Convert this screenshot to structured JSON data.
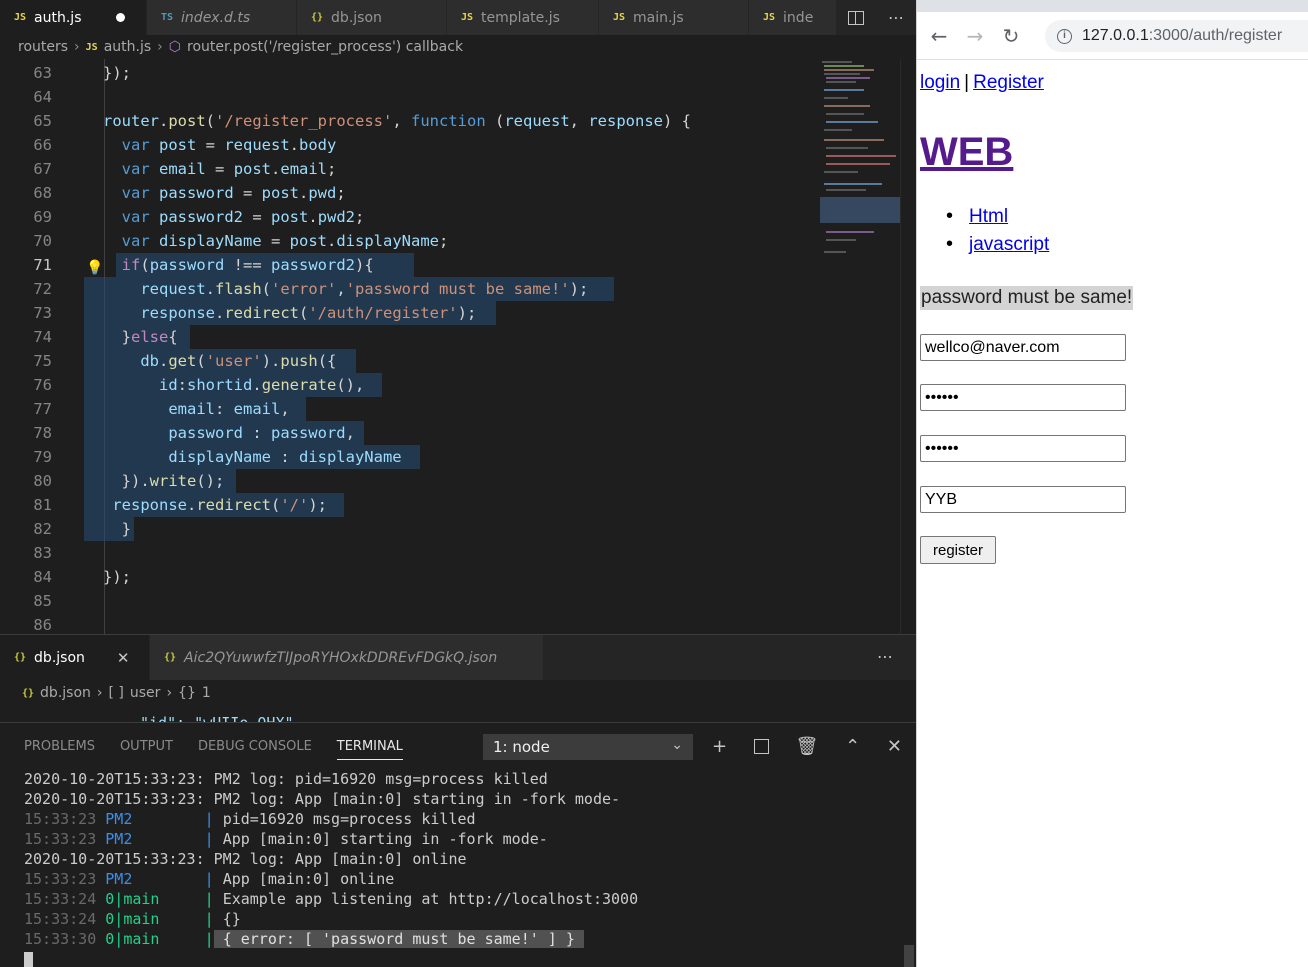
{
  "editor": {
    "tabs": [
      {
        "icon": "JS",
        "label": "auth.js",
        "dirty": true
      },
      {
        "icon": "TS",
        "label": "index.d.ts"
      },
      {
        "icon": "{}",
        "label": "db.json"
      },
      {
        "icon": "JS",
        "label": "template.js"
      },
      {
        "icon": "JS",
        "label": "main.js"
      },
      {
        "icon": "JS",
        "label": "inde"
      }
    ],
    "breadcrumb": {
      "folder": "routers",
      "file_icon": "JS",
      "file": "auth.js",
      "symbol": "router.post('/register_process') callback"
    },
    "lines": [
      "63",
      "64",
      "65",
      "66",
      "67",
      "68",
      "69",
      "70",
      "71",
      "72",
      "73",
      "74",
      "75",
      "76",
      "77",
      "78",
      "79",
      "80",
      "81",
      "82",
      "83",
      "84",
      "85",
      "86"
    ]
  },
  "editor2": {
    "tabs": [
      {
        "icon": "{}",
        "label": "db.json"
      },
      {
        "icon": "{}",
        "label": "Aic2QYuwwfzTIJpoRYHOxkDDREvFDGkQ.json"
      }
    ],
    "breadcrumb": {
      "icon": "{}",
      "file": "db.json",
      "arr_icon": "[ ]",
      "arr": "user",
      "obj_icon": "{}",
      "obj": "1"
    },
    "partial_line": "\"id\": \"wUIIo_OHX\""
  },
  "panel": {
    "tabs": [
      "PROBLEMS",
      "OUTPUT",
      "DEBUG CONSOLE",
      "TERMINAL"
    ],
    "active_tab": "TERMINAL",
    "terminal_select": "1: node",
    "log": [
      "2020-10-20T15:33:23: PM2 log: pid=16920 msg=process killed",
      "2020-10-20T15:33:23: PM2 log: App [main:0] starting in -fork mode-",
      "2020-10-20T15:33:23: PM2 log: App [main:0] online"
    ],
    "rows": [
      {
        "time": "15:33:23",
        "src": "PM2",
        "msg": "pid=16920 msg=process killed"
      },
      {
        "time": "15:33:23",
        "src": "PM2",
        "msg": "App [main:0] starting in -fork mode-"
      },
      {
        "time": "15:33:23",
        "src": "PM2",
        "msg": "App [main:0] online"
      },
      {
        "time": "15:33:24",
        "src": "0|main",
        "msg": "Example app listening at http://localhost:3000"
      },
      {
        "time": "15:33:24",
        "src": "0|main",
        "msg": "{}"
      },
      {
        "time": "15:33:30",
        "src": "0|main",
        "msg": "{ error: [ 'password must be same!' ] }"
      }
    ]
  },
  "browser": {
    "url_host": "127.0.0.1",
    "url_path": ":3000/auth/register",
    "links": {
      "login": "login",
      "separator": "|",
      "register": "Register"
    },
    "title": "WEB",
    "nav": [
      "Html",
      "javascript"
    ],
    "flash": "password must be same!",
    "form": {
      "email": "wellco@naver.com",
      "pwd": "••••••",
      "pwd2": "••••••",
      "displayName": "YYB",
      "submit": "register"
    }
  }
}
